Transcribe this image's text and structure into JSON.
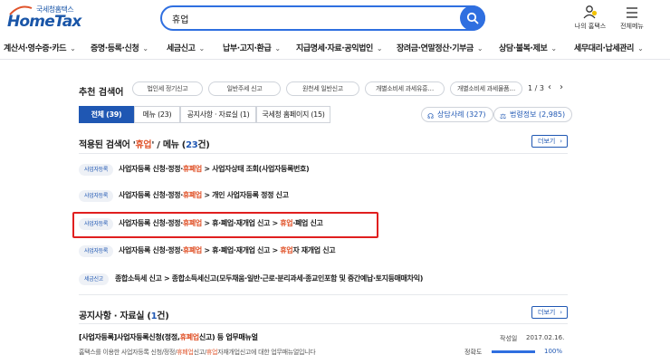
{
  "logo": {
    "small": "국세청홈택스",
    "big": "HomeTax"
  },
  "search": {
    "value": "휴업"
  },
  "tools": [
    {
      "label": "나의 홈택스",
      "icon": "user-bell-icon"
    },
    {
      "label": "전체메뉴",
      "icon": "hamburger-menu-icon"
    }
  ],
  "nav": [
    "계산서·영수증·카드",
    "증명·등록·신청",
    "세금신고",
    "납부·고지·환급",
    "지급명세·자료·공익법인",
    "장려금·연말정산·기부금",
    "상담·불복·제보",
    "세무대리·납세관리"
  ],
  "recommended": {
    "title": "추천 검색어",
    "chips": [
      "법인세 정기신고",
      "일반주세 신고",
      "원천세 일반신고",
      "개별소비세 과세유흥…",
      "개별소비세 과세물품…"
    ],
    "page": "1 / 3"
  },
  "tabs": [
    "전체 (39)",
    "메뉴 (23)",
    "공지사항 · 자료실 (1)",
    "국세청 홈페이지 (15)"
  ],
  "pills": [
    "상담사례 (327)",
    "법령정보 (2,985)"
  ],
  "menu_section": {
    "prefix": "적용된 검색어 '",
    "keyword": "휴업",
    "middle": "' / 메뉴 (",
    "count": "23",
    "suffix": "건)"
  },
  "more_label": "더보기",
  "menu_rows": [
    {
      "badge": "사업자등록",
      "pre": "사업자등록 신청·정정·",
      "hl": "휴폐업",
      "post": " > 사업자상태 조회(사업자등록번호)"
    },
    {
      "badge": "사업자등록",
      "pre": "사업자등록 신청·정정·",
      "hl": "휴폐업",
      "post": " > 개인 사업자등록 정정 신고"
    },
    {
      "badge": "사업자등록",
      "pre": "사업자등록 신청·정정·",
      "hl": "휴폐업",
      "post": " > 휴·폐업·재개업 신고 > ",
      "hl2": "휴업",
      "post2": "·폐업 신고"
    },
    {
      "badge": "사업자등록",
      "pre": "사업자등록 신청·정정·",
      "hl": "휴폐업",
      "post": " > 휴·폐업·재개업 신고 > ",
      "hl2": "휴업",
      "post2": "자 재개업 신고"
    },
    {
      "badge": "세금신고",
      "pre": "종합소득세 신고 > 종합소득세신고(모두채움·일반·근로·분리과세·종교인포함 및 중간예납·토지등매매차익)",
      "hl": "",
      "post": ""
    }
  ],
  "notice_section": {
    "prefix": "공지사항 · 자료실 (",
    "count": "1",
    "suffix": "건)"
  },
  "notice": {
    "title_pre": "[사업자등록]사업자등록신청(정정,",
    "title_hl": "휴폐업",
    "title_post": "신고) 등 업무매뉴얼",
    "desc_pre": "홈택스를 이용한 사업자등록 신청/정정/",
    "desc_hl1": "휴폐업",
    "desc_mid": "신고/",
    "desc_hl2": "휴업",
    "desc_post": "자재개업신고에 대한 업무매뉴얼입니다",
    "date_label": "작성일",
    "date": "2017.02.16.",
    "accuracy_label": "정확도",
    "accuracy": "100%",
    "accuracy_value": 1.0
  },
  "colors": {
    "brand": "#1f57b3",
    "search_border": "#2f6fe0",
    "highlight_text": "#e0542b",
    "annotation_box": "#e01f1f"
  }
}
